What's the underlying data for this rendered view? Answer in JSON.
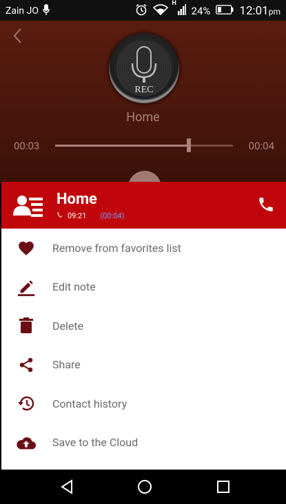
{
  "status_bar": {
    "carrier": "Zain JO",
    "battery": "24%",
    "time": "12:01",
    "ampm": "pm",
    "signal": "H"
  },
  "player": {
    "title": "Home",
    "elapsed": "00:03",
    "total": "00:04",
    "progress_fraction": 0.75,
    "logo_text": "REC"
  },
  "contact": {
    "name": "Home",
    "time": "09:21",
    "duration": "(00:04)"
  },
  "menu": [
    {
      "label": "Remove from favorites list",
      "icon": "heart-icon"
    },
    {
      "label": "Edit note",
      "icon": "pencil-icon"
    },
    {
      "label": "Delete",
      "icon": "trash-icon"
    },
    {
      "label": "Share",
      "icon": "share-icon"
    },
    {
      "label": "Contact history",
      "icon": "history-icon"
    },
    {
      "label": "Save to the Cloud",
      "icon": "cloud-upload-icon"
    }
  ],
  "colors": {
    "accent": "#c0060a",
    "icon": "#6b0f16",
    "menu_text": "#6a6a6a",
    "player_bg": "#4a160c"
  }
}
